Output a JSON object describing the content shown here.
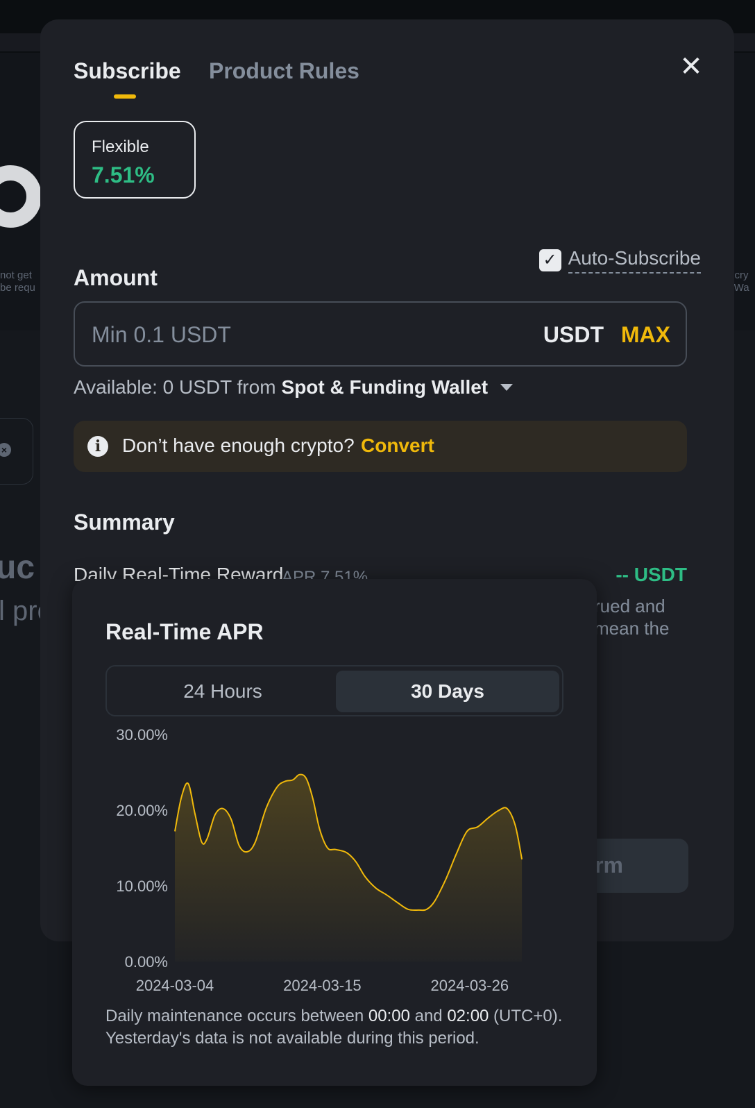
{
  "background": {
    "bg_text_left_1": "not get",
    "bg_text_left_2": "be requ",
    "bg_text_right_1": "o cry",
    "bg_text_right_2": "k Wa",
    "bg_heading": "uc",
    "bg_sub": "l pro"
  },
  "tabs": [
    {
      "label": "Subscribe",
      "active": true
    },
    {
      "label": "Product Rules",
      "active": false
    }
  ],
  "close_glyph": "✕",
  "product": {
    "term": "Flexible",
    "rate": "7.51%"
  },
  "amount": {
    "title": "Amount",
    "auto_subscribe_label": "Auto-Subscribe",
    "auto_subscribe_checked": true,
    "placeholder": "Min 0.1 USDT",
    "currency": "USDT",
    "max_label": "MAX",
    "available_text": "Available: 0 USDT from",
    "wallet": "Spot & Funding Wallet"
  },
  "notice": {
    "text": "Don’t have enough crypto?",
    "action": "Convert"
  },
  "summary": {
    "title": "Summary",
    "reward_label": "Daily Real-Time Reward",
    "reward_apr": "APR 7.51%",
    "reward_value": "-- USDT",
    "partial_text_1": "rued and",
    "partial_text_2": "mean the",
    "confirm_partial": "rm"
  },
  "popup": {
    "title": "Real-Time APR",
    "segments": [
      "24 Hours",
      "30 Days"
    ],
    "active_segment": "30 Days",
    "note_pre": "Daily maintenance occurs between ",
    "note_t1": "00:00",
    "note_mid": " and ",
    "note_t2": "02:00",
    "note_post": " (UTC+0). Yesterday's data is not available during this period."
  },
  "colors": {
    "accent": "#f0b90b",
    "positive": "#2ebd85",
    "line": "#f0b90b"
  },
  "chart_data": {
    "type": "area",
    "title": "Real-Time APR",
    "y_ticks": [
      "30.00%",
      "20.00%",
      "10.00%",
      "0.00%"
    ],
    "ylim": [
      0,
      30
    ],
    "x_ticks": [
      {
        "label": "2024-03-04",
        "day": 4
      },
      {
        "label": "2024-03-15",
        "day": 15
      },
      {
        "label": "2024-03-26",
        "day": 26
      }
    ],
    "xlim_day": [
      4,
      33
    ],
    "series": [
      {
        "values": [
          {
            "day": 4.0,
            "y": 17.2
          },
          {
            "day": 4.5,
            "y": 21.8
          },
          {
            "day": 5.0,
            "y": 23.5
          },
          {
            "day": 5.5,
            "y": 19.5
          },
          {
            "day": 6.0,
            "y": 15.8
          },
          {
            "day": 6.4,
            "y": 16.2
          },
          {
            "day": 7.0,
            "y": 19.4
          },
          {
            "day": 7.6,
            "y": 20.2
          },
          {
            "day": 8.2,
            "y": 18.8
          },
          {
            "day": 8.8,
            "y": 15.3
          },
          {
            "day": 9.4,
            "y": 14.5
          },
          {
            "day": 10.0,
            "y": 15.8
          },
          {
            "day": 10.8,
            "y": 20.2
          },
          {
            "day": 11.6,
            "y": 23.0
          },
          {
            "day": 12.2,
            "y": 23.8
          },
          {
            "day": 12.8,
            "y": 24.0
          },
          {
            "day": 13.3,
            "y": 24.7
          },
          {
            "day": 13.8,
            "y": 24.2
          },
          {
            "day": 14.3,
            "y": 21.5
          },
          {
            "day": 14.8,
            "y": 17.5
          },
          {
            "day": 15.4,
            "y": 15.0
          },
          {
            "day": 16.0,
            "y": 14.8
          },
          {
            "day": 16.8,
            "y": 14.4
          },
          {
            "day": 17.5,
            "y": 13.2
          },
          {
            "day": 18.2,
            "y": 11.2
          },
          {
            "day": 19.0,
            "y": 9.7
          },
          {
            "day": 19.8,
            "y": 8.8
          },
          {
            "day": 20.6,
            "y": 7.8
          },
          {
            "day": 21.4,
            "y": 6.9
          },
          {
            "day": 22.2,
            "y": 6.8
          },
          {
            "day": 22.8,
            "y": 6.9
          },
          {
            "day": 23.4,
            "y": 8.0
          },
          {
            "day": 24.2,
            "y": 10.8
          },
          {
            "day": 25.0,
            "y": 14.2
          },
          {
            "day": 25.8,
            "y": 17.2
          },
          {
            "day": 26.6,
            "y": 17.8
          },
          {
            "day": 27.4,
            "y": 19.0
          },
          {
            "day": 28.2,
            "y": 20.0
          },
          {
            "day": 28.8,
            "y": 20.2
          },
          {
            "day": 29.4,
            "y": 18.0
          },
          {
            "day": 29.9,
            "y": 13.5
          }
        ]
      }
    ]
  }
}
